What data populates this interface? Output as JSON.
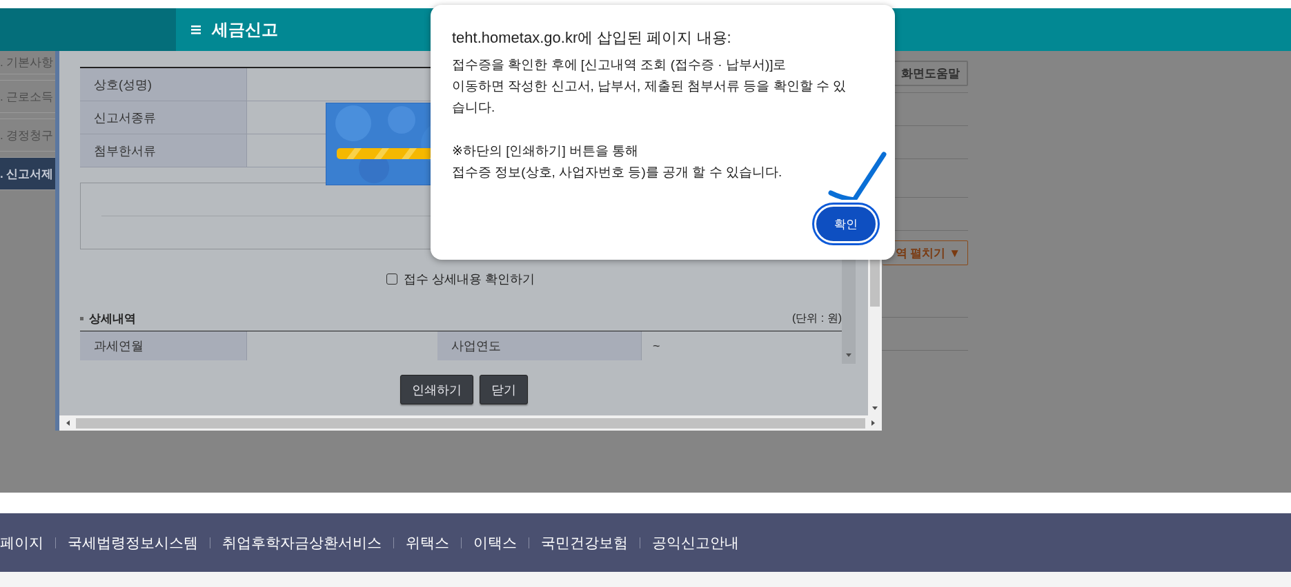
{
  "header": {
    "title": "세금신고"
  },
  "sidebar": {
    "items": [
      {
        "label": ". 기본사항",
        "selected": false
      },
      {
        "label": ". 근로소득",
        "selected": false
      },
      {
        "label": ". 경정청구",
        "selected": false
      },
      {
        "label": ". 신고서제",
        "selected": true
      }
    ]
  },
  "help_button": "화면도움말",
  "expand_button": "역 펼치기 ▼",
  "popup": {
    "summary_rows": [
      {
        "label": "상호(성명)"
      },
      {
        "label": "신고서종류"
      },
      {
        "label": "첨부한서류"
      }
    ],
    "loading": {
      "kind": "picture"
    },
    "checkbox": {
      "label": "접수 상세내용 확인하기",
      "checked": false
    },
    "detail_title": "상세내역",
    "unit": "(단위 : 원)",
    "detail_cells": [
      {
        "label": "과세연월"
      },
      {
        "label": "사업연도",
        "value": "~"
      }
    ],
    "buttons": [
      "인쇄하기",
      "닫기"
    ]
  },
  "dialog": {
    "title": "teht.hometax.go.kr에 삽입된 페이지 내용:",
    "paragraphs": [
      [
        "접수증을 확인한 후에 [신고내역 조회 (접수증 · 납부서)]로",
        "이동하면 작성한 신고서, 납부서, 제출된 첨부서류 등을 확인할 수 있",
        "습니다."
      ],
      [
        "※하단의 [인쇄하기] 버튼을 통해",
        "접수증 정보(상호, 사업자번호 등)를 공개 할 수 있습니다."
      ]
    ],
    "ok_button": "확인"
  },
  "footer": {
    "links": [
      "페이지",
      "국세법령정보시스템",
      "취업후학자금상환서비스",
      "위택스",
      "이택스",
      "국민건강보험",
      "공익신고안내"
    ]
  }
}
